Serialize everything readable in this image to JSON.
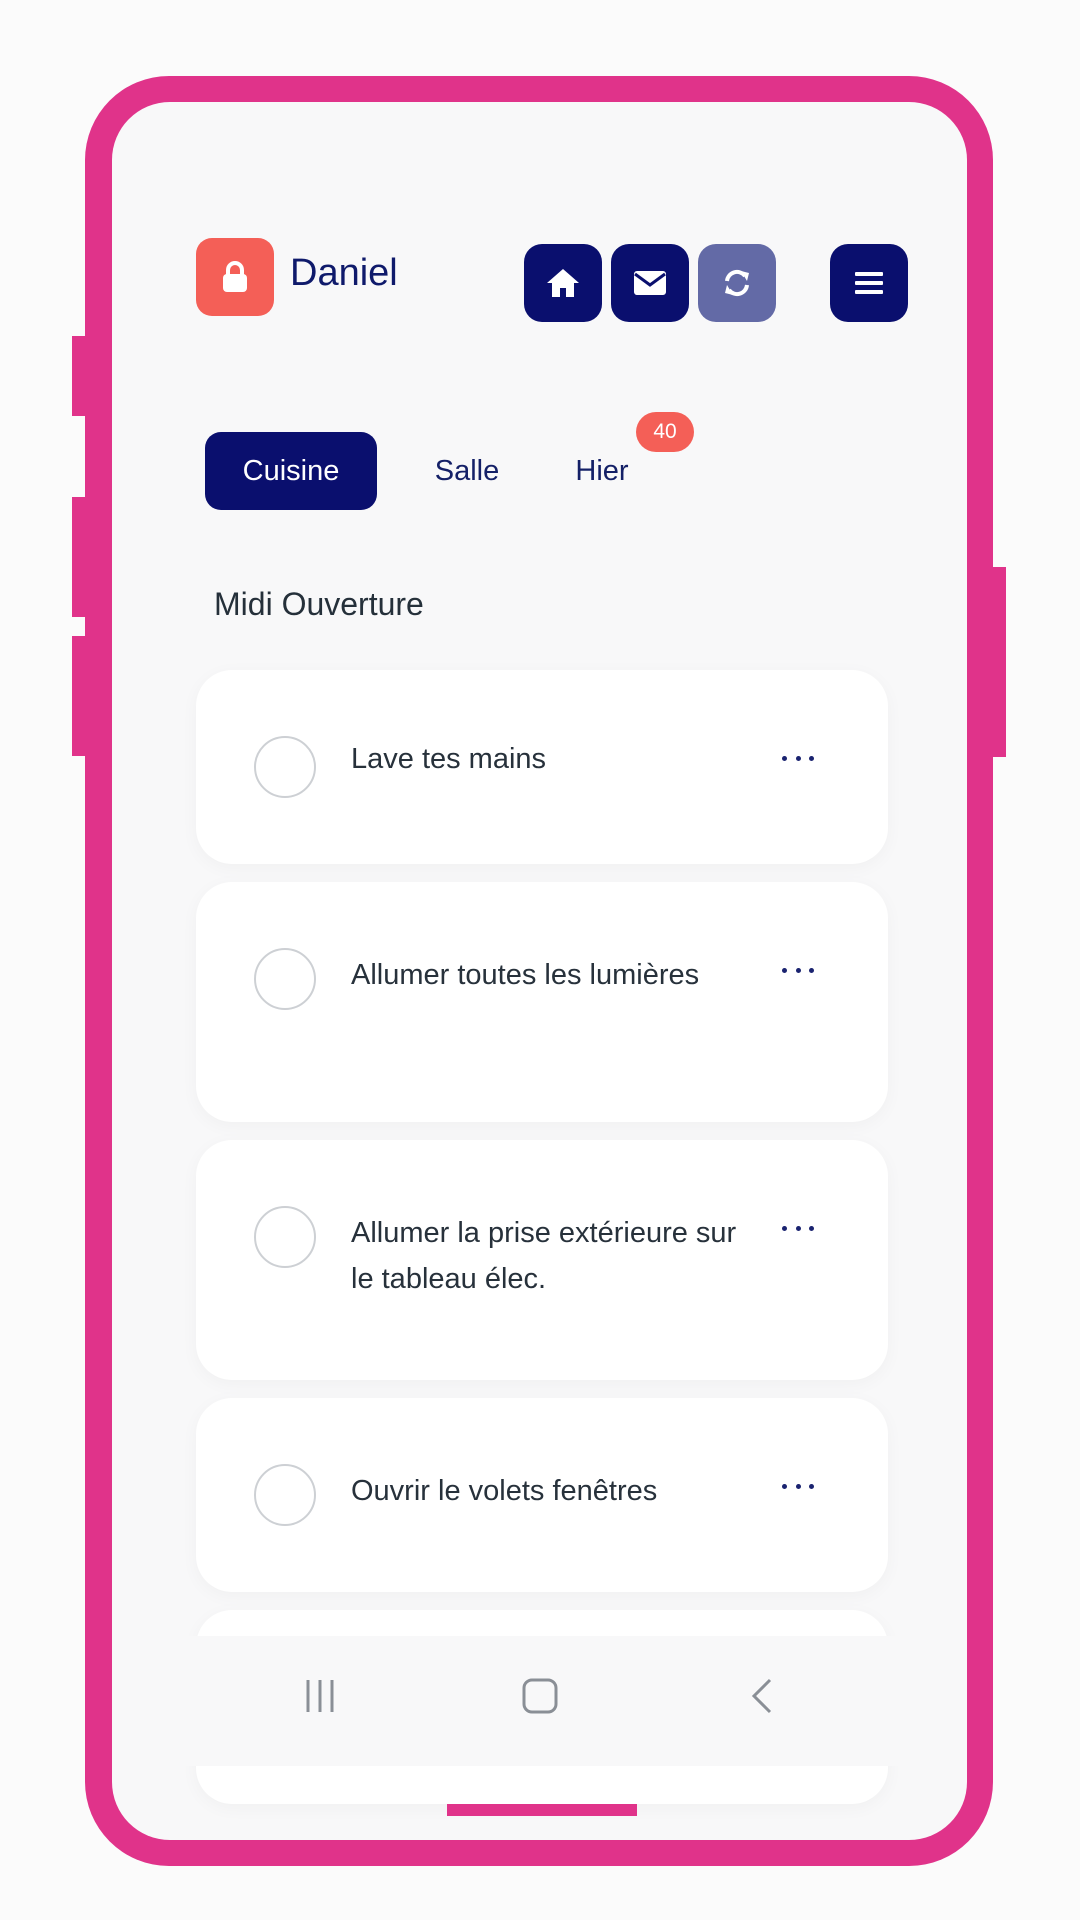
{
  "user": {
    "name": "Daniel",
    "lock_icon": "lock-icon"
  },
  "toolbar": {
    "buttons": [
      {
        "icon": "home-icon",
        "state": "active"
      },
      {
        "icon": "mail-icon",
        "state": "active"
      },
      {
        "icon": "refresh-icon",
        "state": "disabled"
      },
      {
        "icon": "menu-icon",
        "state": "active"
      }
    ]
  },
  "tabs": [
    {
      "label": "Cuisine",
      "active": true
    },
    {
      "label": "Salle",
      "active": false
    },
    {
      "label": "Hier",
      "active": false,
      "badge": "40"
    }
  ],
  "section": {
    "title": "Midi Ouverture"
  },
  "tasks": [
    {
      "label": "Lave tes mains",
      "checked": false
    },
    {
      "label": "Allumer toutes les lumières",
      "checked": false
    },
    {
      "label": "Allumer la prise extérieure sur le tableau élec.",
      "checked": false
    },
    {
      "label": "Ouvrir le volets fenêtres",
      "checked": false
    }
  ],
  "system_nav": {
    "items": [
      "recent-apps-icon",
      "home-circle-icon",
      "back-icon"
    ]
  },
  "colors": {
    "frame": "#e0338a",
    "primary": "#0a0f6e",
    "accent": "#f45f57",
    "disabled": "#636aa6"
  }
}
